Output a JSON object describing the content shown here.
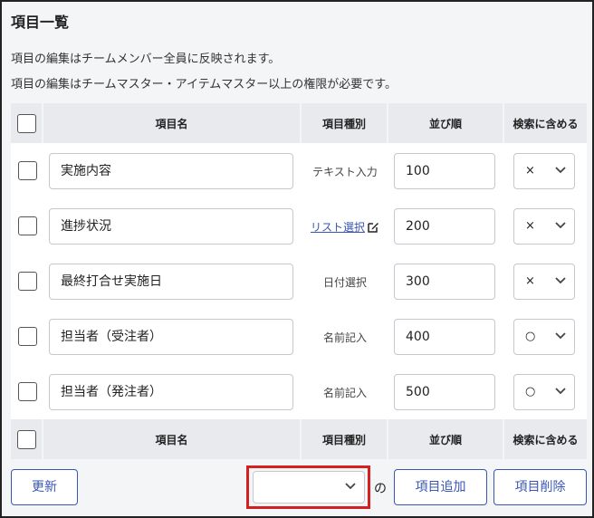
{
  "page": {
    "title": "項目一覧",
    "note1": "項目の編集はチームメンバー全員に反映されます。",
    "note2": "項目の編集はチームマスター・アイテムマスター以上の権限が必要です。"
  },
  "table": {
    "headers": {
      "name": "項目名",
      "type": "項目種別",
      "order": "並び順",
      "search": "検索に含める"
    },
    "rows": [
      {
        "name": "実施内容",
        "type": "テキスト入力",
        "type_is_link": false,
        "order": "100",
        "search": "×"
      },
      {
        "name": "進捗状況",
        "type": "リスト選択",
        "type_is_link": true,
        "order": "200",
        "search": "×"
      },
      {
        "name": "最終打合せ実施日",
        "type": "日付選択",
        "type_is_link": false,
        "order": "300",
        "search": "×"
      },
      {
        "name": "担当者（受注者）",
        "type": "名前記入",
        "type_is_link": false,
        "order": "400",
        "search": "○"
      },
      {
        "name": "担当者（発注者）",
        "type": "名前記入",
        "type_is_link": false,
        "order": "500",
        "search": "○"
      }
    ]
  },
  "footer": {
    "update_label": "更新",
    "type_select_value": "",
    "no_label": "の",
    "add_label": "項目追加",
    "delete_label": "項目削除"
  },
  "colors": {
    "accent": "#3a56b5",
    "highlight": "#d42020",
    "header_bg": "#e8eaee"
  }
}
